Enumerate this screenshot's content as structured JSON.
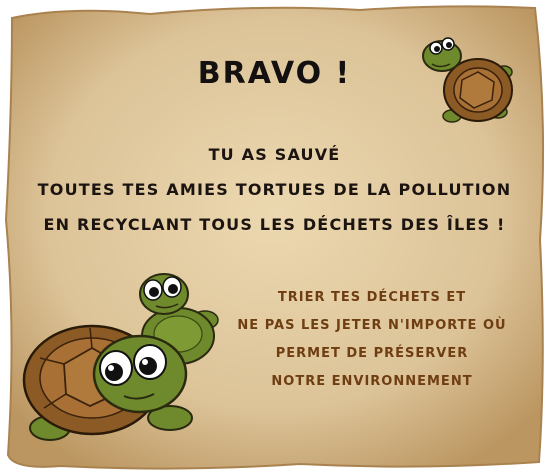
{
  "title": "BRAVO !",
  "message": {
    "line1": "TU AS SAUVÉ",
    "line2": "TOUTES TES AMIES TORTUES DE LA POLLUTION",
    "line3": "EN RECYCLANT TOUS LES DÉCHETS DES ÎLES !"
  },
  "tip": {
    "line1": "TRIER TES DÉCHETS ET",
    "line2": "NE PAS LES JETER N'IMPORTE OÙ",
    "line3": "PERMET DE PRÉSERVER",
    "line4": "NOTRE ENVIRONNEMENT"
  },
  "colors": {
    "parchment": "#dcc398",
    "parchment_edge": "#b08b58",
    "title": "#141010",
    "tip_text": "#6f3d12",
    "turtle_skin": "#6f8a2c",
    "turtle_shell": "#8c5a25"
  }
}
